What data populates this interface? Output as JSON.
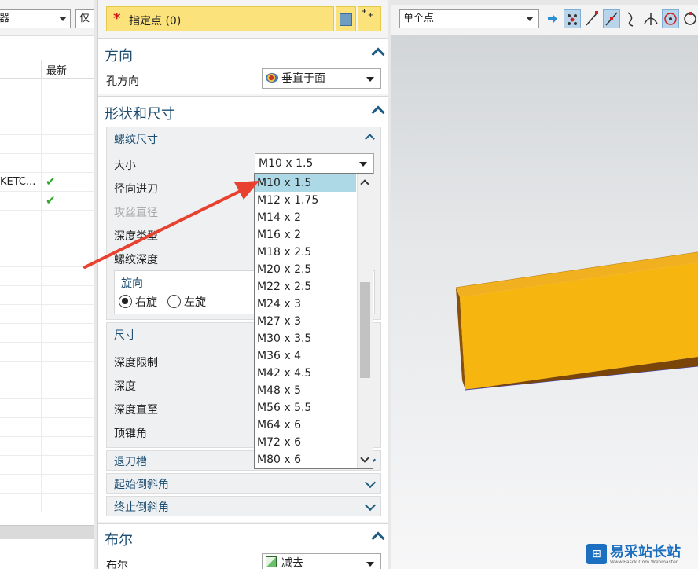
{
  "navigator": {
    "filter_combo": "器",
    "filter_combo2": "仅",
    "column_latest": "最新",
    "rows": [
      {
        "name": "",
        "check": ""
      },
      {
        "name": "",
        "check": ""
      },
      {
        "name": "",
        "check": ""
      },
      {
        "name": "",
        "check": ""
      },
      {
        "name": "",
        "check": ""
      },
      {
        "name": "KETC...",
        "check": "✔"
      },
      {
        "name": "",
        "check": "✔"
      },
      {
        "name": "",
        "check": ""
      },
      {
        "name": "",
        "check": ""
      },
      {
        "name": "",
        "check": ""
      },
      {
        "name": "",
        "check": ""
      },
      {
        "name": "",
        "check": ""
      },
      {
        "name": "",
        "check": ""
      },
      {
        "name": "",
        "check": ""
      },
      {
        "name": "",
        "check": ""
      },
      {
        "name": "",
        "check": ""
      },
      {
        "name": "",
        "check": ""
      },
      {
        "name": "",
        "check": ""
      },
      {
        "name": "",
        "check": ""
      },
      {
        "name": "",
        "check": ""
      },
      {
        "name": "",
        "check": ""
      },
      {
        "name": "",
        "check": ""
      },
      {
        "name": "",
        "check": ""
      }
    ]
  },
  "dialog": {
    "specify_point": {
      "required_mark": "*",
      "label": "指定点 (0)",
      "add_icon_text": "⁺₊"
    },
    "direction": {
      "title": "方向",
      "hole_direction_label": "孔方向",
      "hole_direction_value": "垂直于面"
    },
    "shape": {
      "title": "形状和尺寸",
      "thread_size": {
        "title": "螺纹尺寸",
        "size_label": "大小",
        "size_value": "M10 x 1.5",
        "radial_feed_label": "径向进刀",
        "tap_drill_label": "攻丝直径",
        "depth_type_label": "深度类型",
        "thread_depth_label": "螺纹深度",
        "rotation": {
          "title": "旋向",
          "right_label": "右旋",
          "left_label": "左旋",
          "selected": "right"
        }
      },
      "dimensions": {
        "title": "尺寸",
        "depth_limit_label": "深度限制",
        "depth_label": "深度",
        "depth_to_label": "深度直至",
        "tip_angle_label": "顶锥角"
      },
      "relief": "退刀槽",
      "start_chamfer": "起始倒斜角",
      "end_chamfer": "终止倒斜角"
    },
    "boolean": {
      "title": "布尔",
      "boolean_label": "布尔",
      "boolean_value": "减去"
    }
  },
  "size_list": {
    "options": [
      "M10 x 1.5",
      "M12 x 1.75",
      "M14 x 2",
      "M16 x 2",
      "M18 x 2.5",
      "M20 x 2.5",
      "M22 x 2.5",
      "M24 x 3",
      "M27 x 3",
      "M30 x 3.5",
      "M36 x 4",
      "M42 x 4.5",
      "M48 x 5",
      "M56 x 5.5",
      "M64 x 6",
      "M72 x 6",
      "M80 x 6"
    ],
    "selected_index": 0
  },
  "viewport": {
    "snap_combo": "单个点",
    "part_color": "#f7b50f",
    "watermark": {
      "logo": "⊞",
      "name": "易采站长站",
      "sub": "Www.Easck.Com Webmaster"
    }
  },
  "colors": {
    "select_highlight": "#fce27a",
    "section_title": "#1d4e72",
    "list_selected": "#add8e6",
    "annotation_arrow": "#e8412f"
  }
}
